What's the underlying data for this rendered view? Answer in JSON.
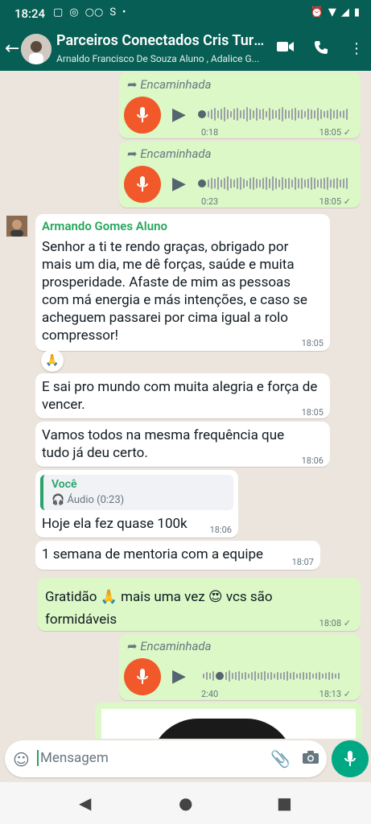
{
  "status": {
    "time": "18:24",
    "extra": "S",
    "dot": "•"
  },
  "header": {
    "title": "Parceiros Conectados Cris Turi...",
    "subtitle": "Arnaldo Francisco De Souza Aluno , Adalice G..."
  },
  "messages": {
    "a1": {
      "forward": "Encaminhada",
      "duration": "0:18",
      "time": "18:05",
      "tick": "✓"
    },
    "a2": {
      "forward": "Encaminhada",
      "duration": "0:23",
      "time": "18:05",
      "tick": "✓"
    },
    "m1": {
      "sender": "Armando Gomes Aluno",
      "text": "Senhor a ti te rendo graças, obrigado por mais um dia, me dê forças, saúde e muita prosperidade. Afaste de mim as pessoas com má energia e más intenções, e caso se acheguem passarei por cima igual a rolo compressor!",
      "time": "18:05",
      "reaction": "🙏"
    },
    "m2": {
      "text": "E sai pro mundo com muita alegria e força de vencer.",
      "time": "18:05"
    },
    "m3": {
      "text": "Vamos todos na mesma frequência que tudo já deu certo.",
      "time": "18:06"
    },
    "m4": {
      "quote_name": "Você",
      "quote_text": "🎧 Áudio (0:23)",
      "text": "Hoje ela fez quase 100k",
      "time": "18:06"
    },
    "m5": {
      "text": "1 semana de mentoria com a equipe",
      "time": "18:07"
    },
    "m6": {
      "text": "Gratidão 🙏 mais uma vez 😍 vcs são formidáveis",
      "time": "18:08",
      "tick": "✓"
    },
    "a3": {
      "forward": "Encaminhada",
      "duration": "2:40",
      "time": "18:13",
      "tick": "✓"
    }
  },
  "input": {
    "placeholder": "Mensagem"
  },
  "icons": {
    "back": "arrow-left-icon",
    "video": "video-icon",
    "call": "phone-icon",
    "menu": "more-vert-icon"
  },
  "colors": {
    "header": "#075e54",
    "outgoing": "#dcf8c6",
    "incoming": "#ffffff",
    "mic": "#f1592a",
    "send": "#00a884"
  }
}
